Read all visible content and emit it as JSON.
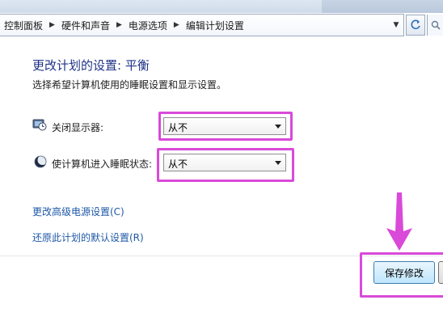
{
  "breadcrumb": {
    "items": [
      "控制面板",
      "硬件和声音",
      "电源选项",
      "编辑计划设置"
    ]
  },
  "icons": {
    "refresh": "refresh-icon",
    "dropdown": "chevron-down-icon",
    "display": "monitor-clock-icon",
    "sleep": "moon-icon",
    "search": "search-icon"
  },
  "main": {
    "title": "更改计划的设置: 平衡",
    "description": "选择希望计算机使用的睡眠设置和显示设置。"
  },
  "settings": {
    "display_off": {
      "label": "关闭显示器:",
      "value": "从不"
    },
    "sleep": {
      "label": "使计算机进入睡眠状态:",
      "value": "从不"
    }
  },
  "links": {
    "advanced": "更改高级电源设置(C)",
    "restore": "还原此计划的默认设置(R)"
  },
  "footer": {
    "save_label": "保存修改"
  },
  "colors": {
    "annotation": "#d94ad9",
    "link": "#1f58a8",
    "title": "#1e3287"
  }
}
